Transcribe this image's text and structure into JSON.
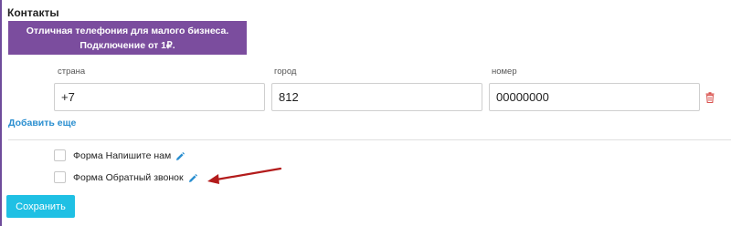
{
  "contacts": {
    "title": "Контакты",
    "banner": {
      "line1": "Отличная телефония для малого бизнеса.",
      "line2": "Подключение от 1₽."
    },
    "fields": {
      "country": {
        "label": "страна",
        "value": "+7"
      },
      "city": {
        "label": "город",
        "value": "812"
      },
      "number": {
        "label": "номер",
        "value": "00000000"
      }
    },
    "delete_icon": "trash-icon",
    "add_more": "Добавить еще"
  },
  "forms": [
    {
      "label": "Форма Напишите нам",
      "checked": false,
      "edit_icon": "pencil-icon"
    },
    {
      "label": "Форма Обратный звонок",
      "checked": false,
      "edit_icon": "pencil-icon"
    }
  ],
  "annotation": {
    "arrow_color": "#b31b1b"
  },
  "colors": {
    "accent": "#2b8fd0",
    "button": "#1fc0e4",
    "banner": "#7b4d9e",
    "danger": "#d9534f"
  },
  "save_label": "Сохранить"
}
